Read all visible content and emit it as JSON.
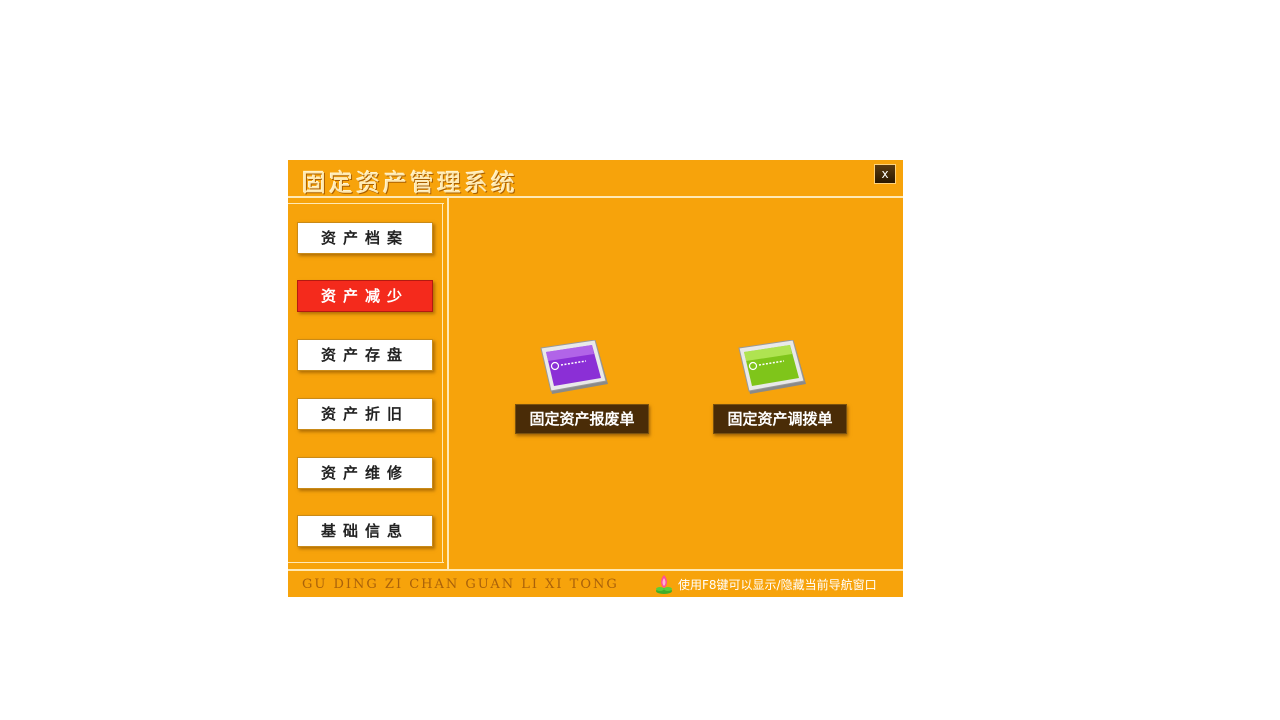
{
  "window": {
    "title": "固定资产管理系统",
    "close_label": "x"
  },
  "sidebar": {
    "items": [
      {
        "label": "资产档案",
        "active": false
      },
      {
        "label": "资产减少",
        "active": true
      },
      {
        "label": "资产存盘",
        "active": false
      },
      {
        "label": "资产折旧",
        "active": false
      },
      {
        "label": "资产维修",
        "active": false
      },
      {
        "label": "基础信息",
        "active": false
      }
    ]
  },
  "main": {
    "documents": [
      {
        "label": "固定资产报废单",
        "icon": "purple-document-icon"
      },
      {
        "label": "固定资产调拨单",
        "icon": "green-document-icon"
      }
    ]
  },
  "footer": {
    "pinyin": "GU DING ZI CHAN GUAN LI XI TONG",
    "hint": "使用F8键可以显示/隐藏当前导航窗口",
    "hint_icon": "lotus-icon"
  },
  "colors": {
    "window_bg": "#f7a30b",
    "active_nav": "#f42a1c",
    "doc_button": "#4a2c07",
    "divider": "#ffe9b6"
  }
}
